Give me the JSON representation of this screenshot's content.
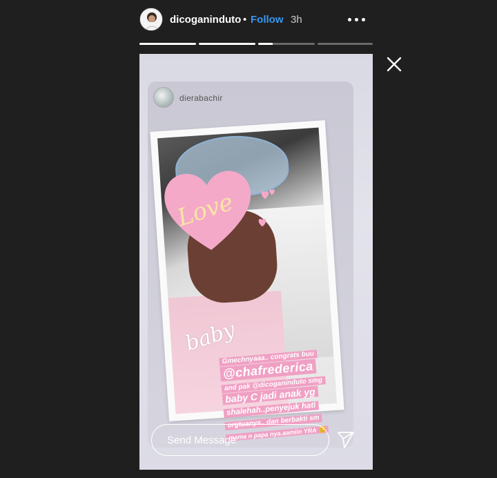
{
  "header": {
    "username": "dicoganinduto",
    "separator": "•",
    "follow_label": "Follow",
    "time_ago": "3h"
  },
  "progress": {
    "segments": 4,
    "fills": [
      1,
      1,
      0.25,
      0
    ]
  },
  "story": {
    "repost_username": "dierabachir",
    "sticker_love": "Love",
    "sticker_baby": "baby",
    "caption_lines": [
      "Gmechnyaaa.. congrats buu",
      "@chafrederica",
      "and pak @dicoganinduto smg",
      "baby C jadi anak yg",
      "shalehah..penyejuk hati",
      "orgtuanya.. dan berbakti sm",
      "mama n papa nya.aamiin YRA 😊"
    ]
  },
  "footer": {
    "message_placeholder": "Send Message"
  },
  "icons": {
    "more": "more-options-icon",
    "close": "close-icon",
    "send": "send-icon"
  },
  "colors": {
    "background": "#1f1f1f",
    "follow": "#3897f0",
    "caption_highlight": "#f0a0c4",
    "heart": "#f4a9c9"
  }
}
